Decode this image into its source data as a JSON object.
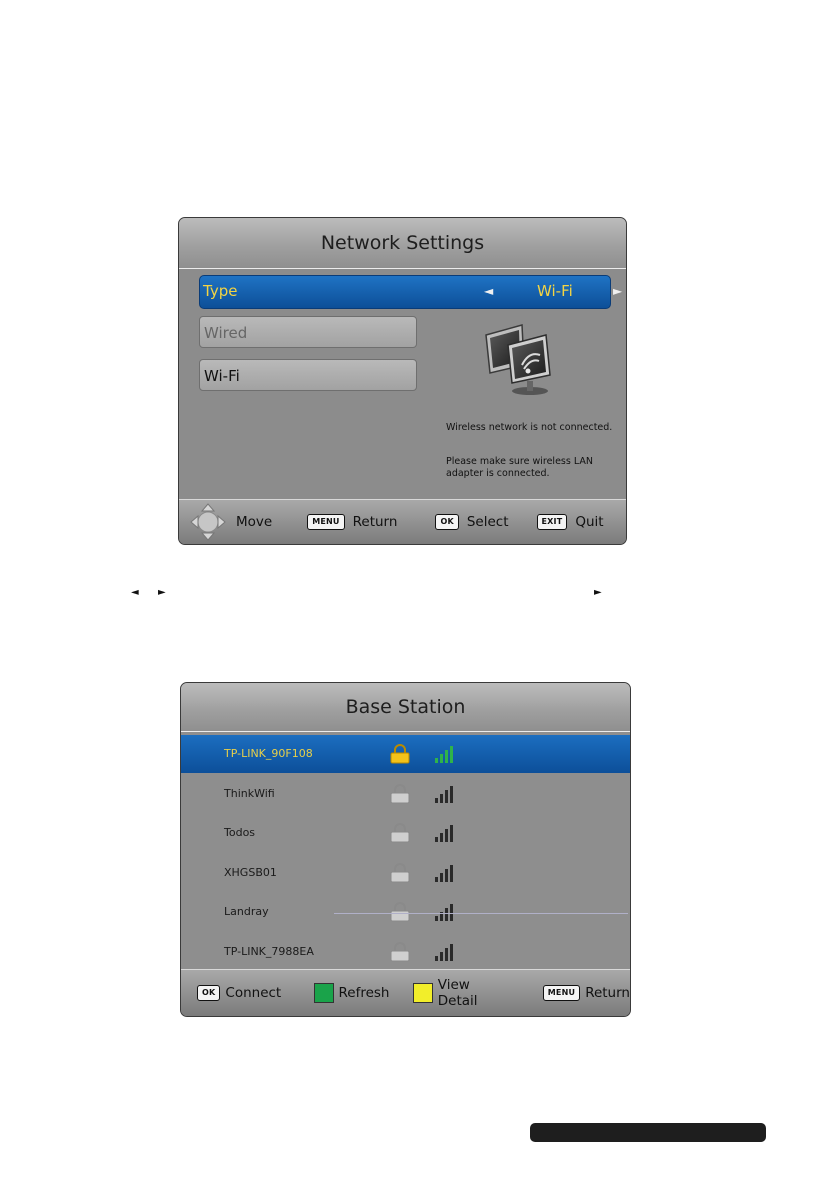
{
  "network_settings": {
    "title": "Network Settings",
    "type_label": "Type",
    "type_value": "Wi-Fi",
    "options": [
      "Wired",
      "Wi-Fi"
    ],
    "status_text": "Wireless network is not connected.",
    "hint_line1": "Please make sure wireless LAN",
    "hint_line2": "adapter is connected.",
    "footer": {
      "move": "Move",
      "menu_key": "MENU",
      "return": "Return",
      "ok_key": "OK",
      "select": "Select",
      "exit_key": "EXIT",
      "quit": "Quit"
    }
  },
  "base_station": {
    "title": "Base Station",
    "networks": [
      {
        "name": "TP-LINK_90F108",
        "locked": true,
        "selected": true
      },
      {
        "name": "ThinkWifi",
        "locked": true,
        "selected": false
      },
      {
        "name": "Todos",
        "locked": true,
        "selected": false
      },
      {
        "name": "XHGSB01",
        "locked": true,
        "selected": false
      },
      {
        "name": "Landray",
        "locked": true,
        "selected": false
      },
      {
        "name": "TP-LINK_7988EA",
        "locked": true,
        "selected": false
      }
    ],
    "footer": {
      "ok_key": "OK",
      "connect": "Connect",
      "refresh": "Refresh",
      "view_detail": "View Detail",
      "menu_key": "MENU",
      "return": "Return"
    }
  },
  "arrow_glyphs": {
    "left": "◄",
    "right": "►"
  },
  "colors": {
    "highlight_blue": "#1565b5",
    "highlight_text": "#f4d443",
    "refresh_key": "#1aa34a",
    "view_detail_key": "#f2ee2a"
  }
}
